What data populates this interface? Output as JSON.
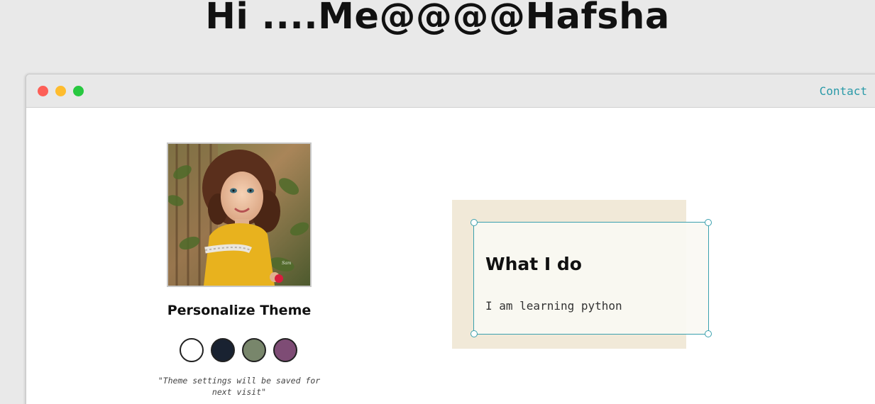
{
  "header": {
    "title": "Hi ....Me@@@@Hafsha"
  },
  "window": {
    "controls": [
      "close",
      "minimize",
      "maximize"
    ],
    "nav": {
      "contact_label": "Contact"
    }
  },
  "profile": {
    "avatar_icon": "portrait-photo",
    "personalize_title": "Personalize Theme",
    "theme_swatches": [
      {
        "name": "light",
        "color": "#ffffff"
      },
      {
        "name": "dark-blue",
        "color": "#192231"
      },
      {
        "name": "green",
        "color": "#78866b"
      },
      {
        "name": "purple",
        "color": "#7e4c75"
      }
    ],
    "theme_note": "\"Theme settings will be saved for next visit\""
  },
  "about": {
    "title": "What I do",
    "text": "I am learning python"
  },
  "colors": {
    "background": "#e9e9e9",
    "accent": "#2a9aa8",
    "card_back": "#f1e9d8"
  }
}
